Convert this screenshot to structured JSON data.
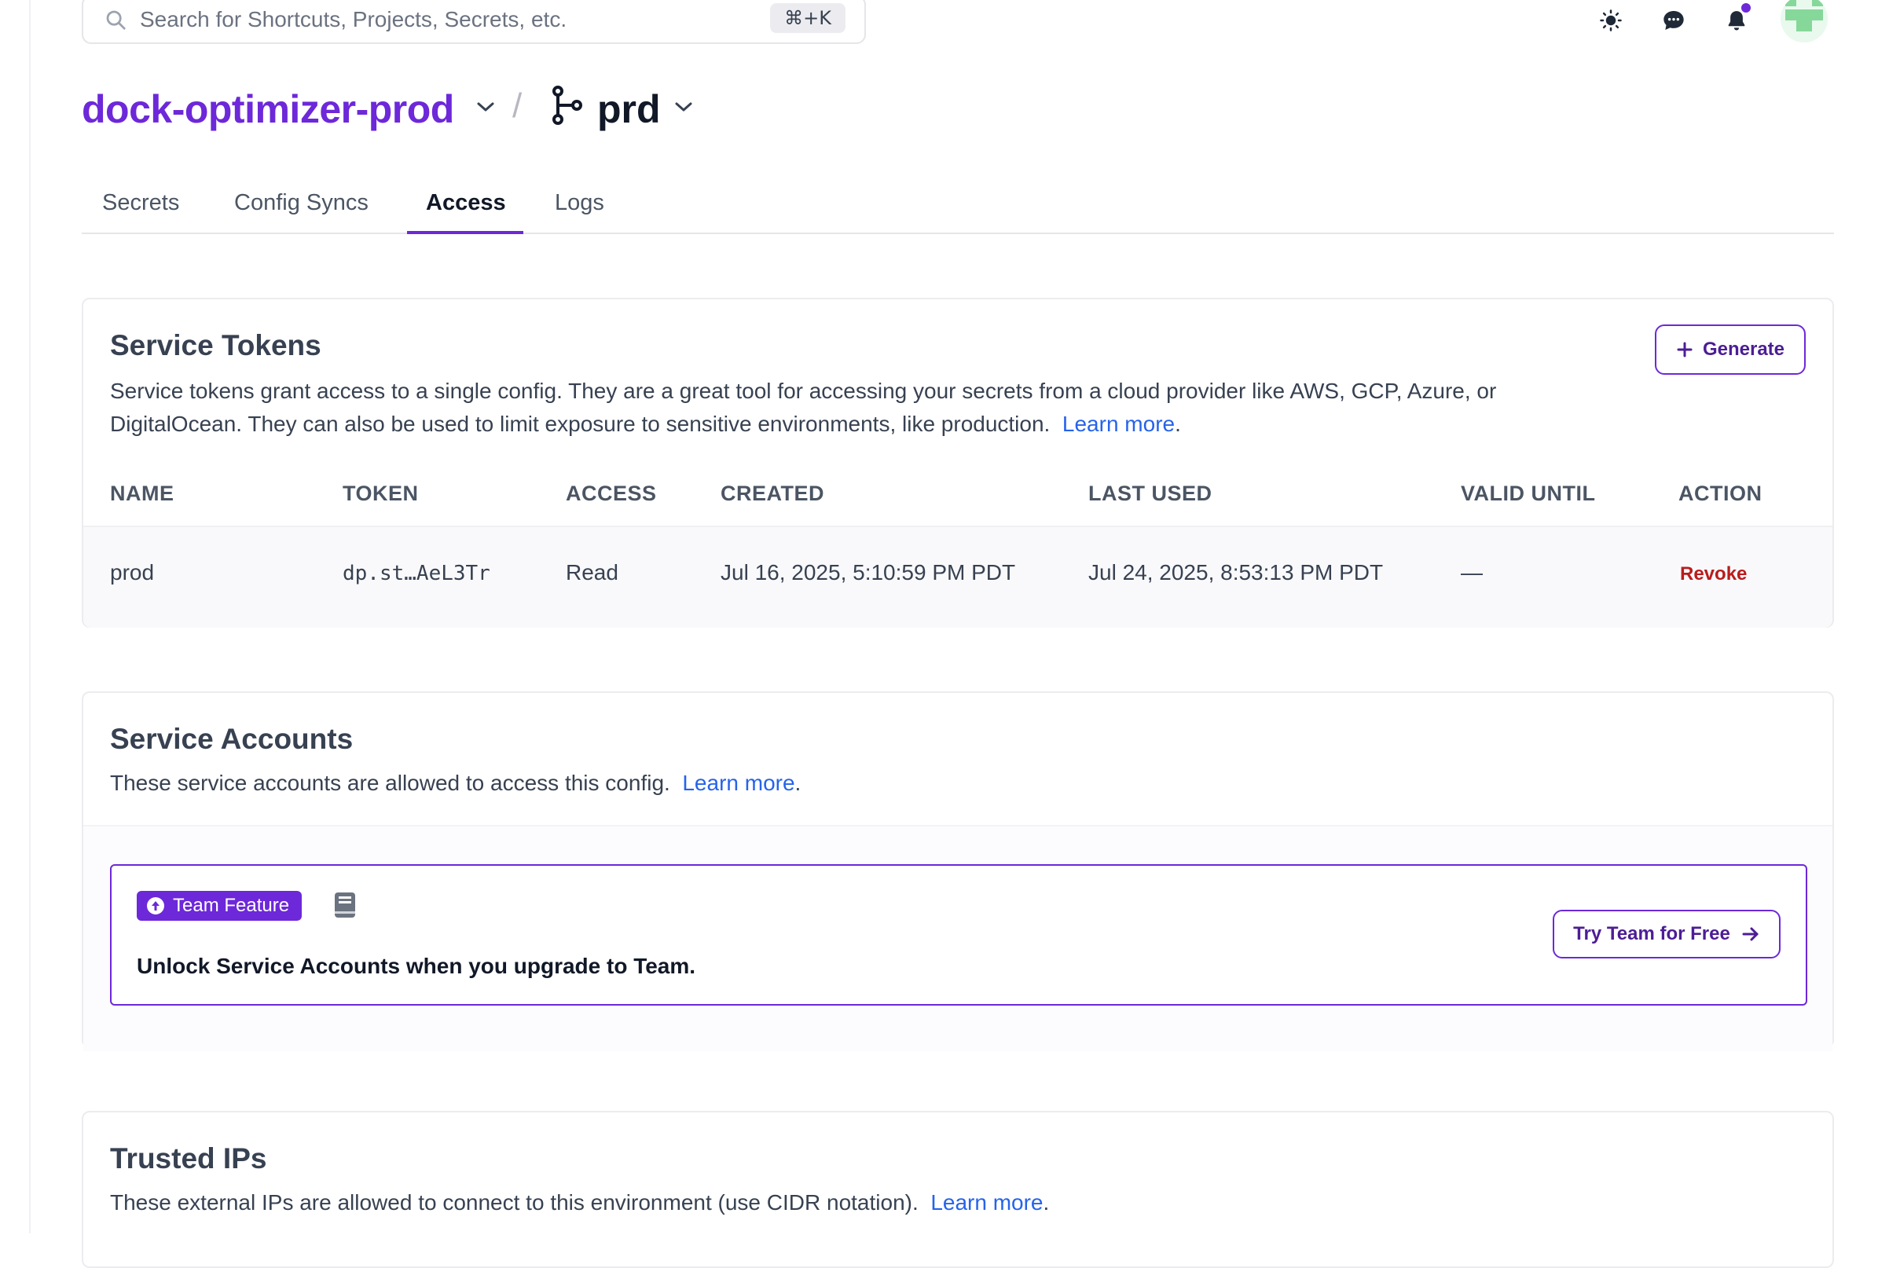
{
  "search": {
    "placeholder": "Search for Shortcuts, Projects, Secrets, etc.",
    "shortcut": "⌘+K"
  },
  "topbar": {
    "icons": [
      "sun-icon",
      "chat-icon",
      "bell-icon",
      "avatar"
    ]
  },
  "header": {
    "project": "dock-optimizer-prod",
    "separator": "/",
    "environment": "prd"
  },
  "tabs": [
    {
      "label": "Secrets"
    },
    {
      "label": "Config Syncs"
    },
    {
      "label": "Access",
      "active": true
    },
    {
      "label": "Logs"
    }
  ],
  "service_tokens": {
    "title": "Service Tokens",
    "description": "Service tokens grant access to a single config. They are a great tool for accessing your secrets from a cloud provider like AWS, GCP, Azure, or DigitalOcean. They can also be used to limit exposure to sensitive environments, like production.",
    "description_line1": "Service tokens grant access to a single config. They are a great tool for accessing your secrets from a cloud provider like AWS, GCP, Azure, or",
    "description_line2": "DigitalOcean. They can also be used to limit exposure to sensitive environments, like production.",
    "learn_more": "Learn more",
    "generate_label": "Generate",
    "columns": [
      "NAME",
      "TOKEN",
      "ACCESS",
      "CREATED",
      "LAST USED",
      "VALID UNTIL",
      "ACTION"
    ],
    "rows": [
      {
        "name": "prod",
        "token": "dp.st…AeL3Tr",
        "access": "Read",
        "created": "Jul 16, 2025, 5:10:59 PM PDT",
        "last_used": "Jul 24, 2025, 8:53:13 PM PDT",
        "valid_until": "—",
        "action": "Revoke"
      }
    ]
  },
  "service_accounts": {
    "title": "Service Accounts",
    "description": "These service accounts are allowed to access this config.",
    "learn_more": "Learn more",
    "badge": "Team Feature",
    "upgrade_text": "Unlock Service Accounts when you upgrade to Team.",
    "try_label": "Try Team for Free"
  },
  "trusted_ips": {
    "title": "Trusted IPs",
    "description": "These external IPs are allowed to connect to this environment (use CIDR notation).",
    "learn_more": "Learn more"
  },
  "colors": {
    "accent": "#6d28d9",
    "link": "#2563eb",
    "danger": "#b91c1c"
  }
}
